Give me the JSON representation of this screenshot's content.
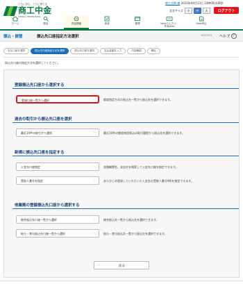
{
  "logo": {
    "sub": "ともに歩む、ともに育てる",
    "main": "商工中金",
    "en": "SHOKO CHUKIN BANK"
  },
  "user": {
    "name": "商工太郎 様",
    "date_text": "2016年04月13日 10時00分00秒"
  },
  "font_size": {
    "label": "文字サイズ",
    "options": [
      "小",
      "中",
      "大"
    ],
    "selected": "中"
  },
  "logout_label": "ログアウト",
  "colors": {
    "brand_green": "#0a7a45",
    "accent_blue": "#1c6db8",
    "logout_red": "#e5141a",
    "highlight_red": "#d8141a"
  },
  "global_nav": [
    {
      "label": "ホーム",
      "icon": "home-icon"
    },
    {
      "label": "照会",
      "icon": "inquiry-icon"
    },
    {
      "label": "資金移動",
      "icon": "transfer-icon",
      "active": true
    },
    {
      "label": "承認",
      "icon": "approval-icon"
    },
    {
      "label": "管理",
      "icon": "admin-icon"
    },
    {
      "label": "Webでんさい・\n外為Web",
      "icon": "densai-icon"
    },
    {
      "label": "Web申込",
      "icon": "apply-icon"
    }
  ],
  "title_bar": {
    "category": "振込・振替",
    "title": "振込先口座指定方法選択",
    "screen_code": "BFKF003",
    "help_label": "ヘルプ"
  },
  "steps": [
    {
      "label": "支払口座を選択"
    },
    {
      "label": "振込先口座指定方法を選択",
      "active": true
    },
    {
      "label": "振込先口座を選択"
    },
    {
      "label": "支払金額を入力"
    },
    {
      "label": "内容確認"
    },
    {
      "label": "確定"
    }
  ],
  "intro_text": "振込先口座の指定方法を選択してください。",
  "sections": [
    {
      "title": "登録振込先口座から選択する",
      "options": [
        {
          "label": "登録口座一覧から選択",
          "description": "都度指定方式の振込先一覧から振込先を選択できます。",
          "highlighted": true
        }
      ]
    },
    {
      "title": "過去の取引から振込先口座を選択",
      "options": [
        {
          "label": "最近10件の取引から選択",
          "description": "最近10件の都度指定振込の取引履歴から振込先を選択できます。"
        }
      ]
    },
    {
      "title": "新規に振込先口座を指定する",
      "options": [
        {
          "label": "入金先口座指定",
          "description": "金融機関名、支店名を検索して入金先口座を指定できます。"
        },
        {
          "label": "受取人番号を指定",
          "description": "あらかじめ登録していただいた入金先の受取人番号9桁を指定できます。"
        }
      ]
    },
    {
      "title": "他業務の登録振込先口座から選択する",
      "options": [
        {
          "label": "総合振込先口座一覧から選択",
          "description": "総合振込先一覧から振込先を選択できます。"
        },
        {
          "label": "給与・賞与振込先口座一覧から選択",
          "description": "給与・賞与振込先一覧から振込先を選択できます。"
        }
      ]
    }
  ],
  "back_label": "戻る"
}
